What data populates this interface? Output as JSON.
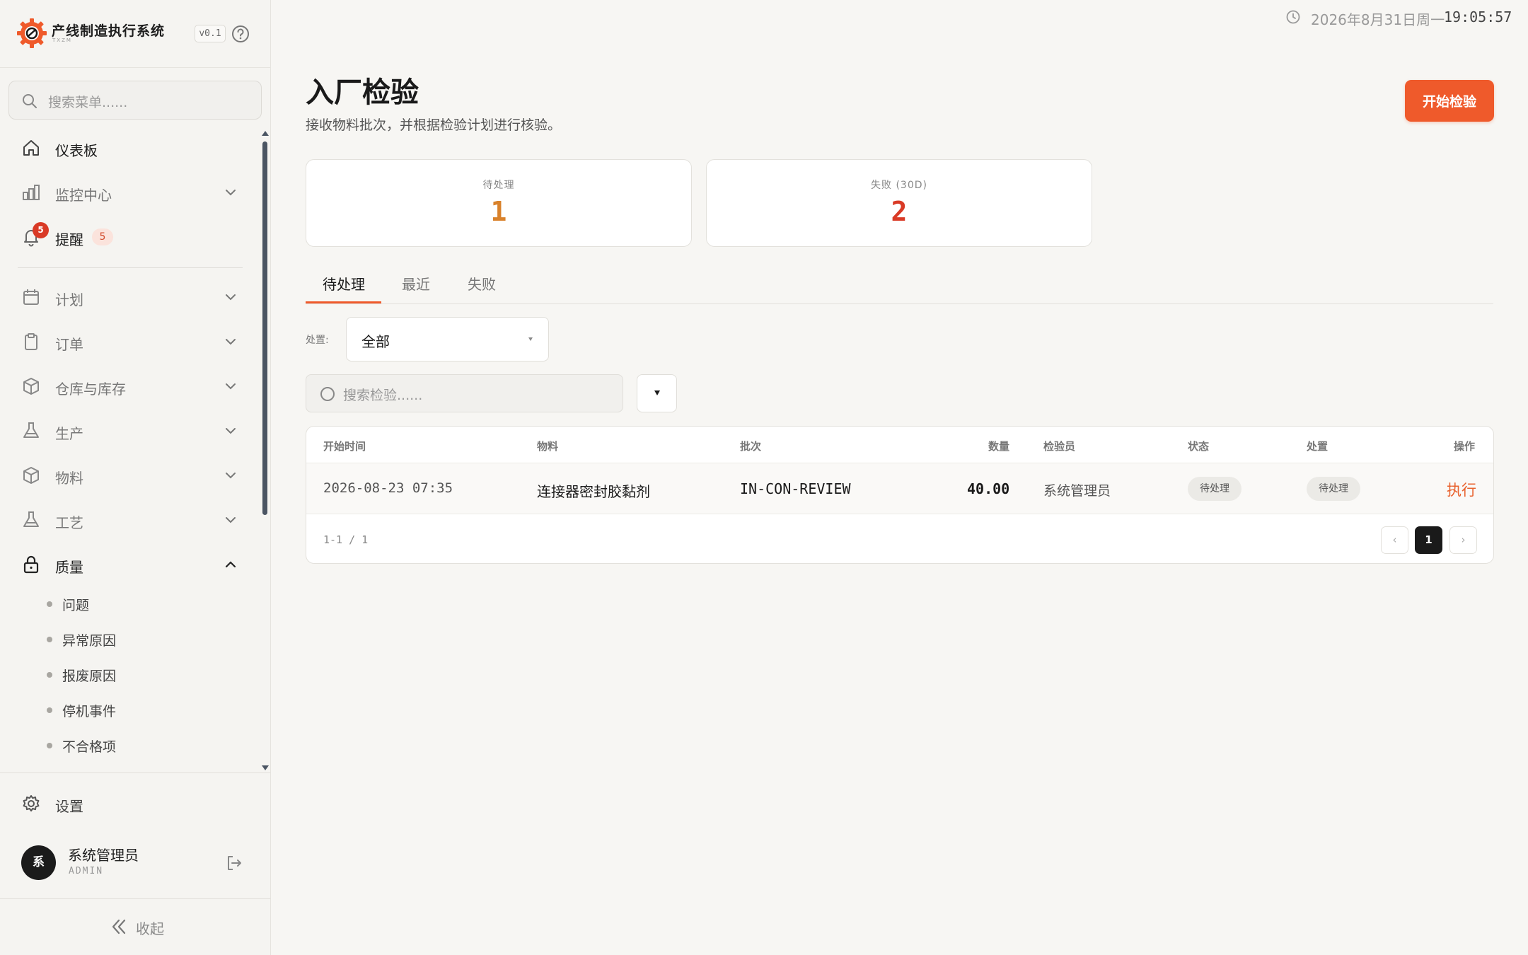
{
  "colors": {
    "accent": "#ef5a2b",
    "pending": "#d9822b",
    "failed": "#d93a26",
    "badge": "#d93a26"
  },
  "brand": {
    "name": "产线制造执行系统",
    "sub": "TXZM",
    "version": "v0.1"
  },
  "sidebar": {
    "search_placeholder": "搜索菜单......",
    "items": [
      {
        "label": "仪表板",
        "icon": "home-icon"
      },
      {
        "label": "监控中心",
        "icon": "bar-chart-icon"
      },
      {
        "label": "提醒",
        "icon": "bell-icon",
        "badge": "5",
        "count": "5"
      },
      {
        "label": "计划",
        "icon": "calendar-icon"
      },
      {
        "label": "订单",
        "icon": "clipboard-icon"
      },
      {
        "label": "仓库与库存",
        "icon": "box-icon"
      },
      {
        "label": "生产",
        "icon": "flask-icon"
      },
      {
        "label": "物料",
        "icon": "box-icon"
      },
      {
        "label": "工艺",
        "icon": "flask-icon"
      },
      {
        "label": "质量",
        "icon": "lock-icon",
        "expanded": true
      }
    ],
    "quality_children": [
      "问题",
      "异常原因",
      "报废原因",
      "停机事件",
      "不合格项"
    ],
    "settings_label": "设置",
    "user": {
      "avatar": "系",
      "name": "系统管理员",
      "role": "ADMIN"
    },
    "collapse_label": "收起"
  },
  "header": {
    "date": "2026年8月31日周一",
    "time": "19:05:57"
  },
  "page": {
    "title": "入厂检验",
    "subtitle": "接收物料批次，并根据检验计划进行核验。",
    "primary_button": "开始检验"
  },
  "stats": [
    {
      "label": "待处理",
      "value": "1"
    },
    {
      "label": "失败 (30D)",
      "value": "2"
    }
  ],
  "tabs": [
    {
      "label": "待处理",
      "active": true
    },
    {
      "label": "最近",
      "active": false
    },
    {
      "label": "失败",
      "active": false
    }
  ],
  "filter": {
    "label": "处置:",
    "selected": "全部"
  },
  "search": {
    "placeholder": "搜索检验......"
  },
  "table": {
    "columns": [
      "开始时间",
      "物料",
      "批次",
      "数量",
      "检验员",
      "状态",
      "处置",
      "操作"
    ],
    "rows": [
      {
        "start_time": "2026-08-23 07:35",
        "material": "连接器密封胶黏剂",
        "batch": "IN-CON-REVIEW",
        "quantity": "40.00",
        "inspector": "系统管理员",
        "status": "待处理",
        "disposition": "待处理",
        "action": "执行"
      }
    ],
    "range": "1-1 / 1",
    "pagination": {
      "prev": "‹",
      "current": "1",
      "next": "›"
    }
  }
}
